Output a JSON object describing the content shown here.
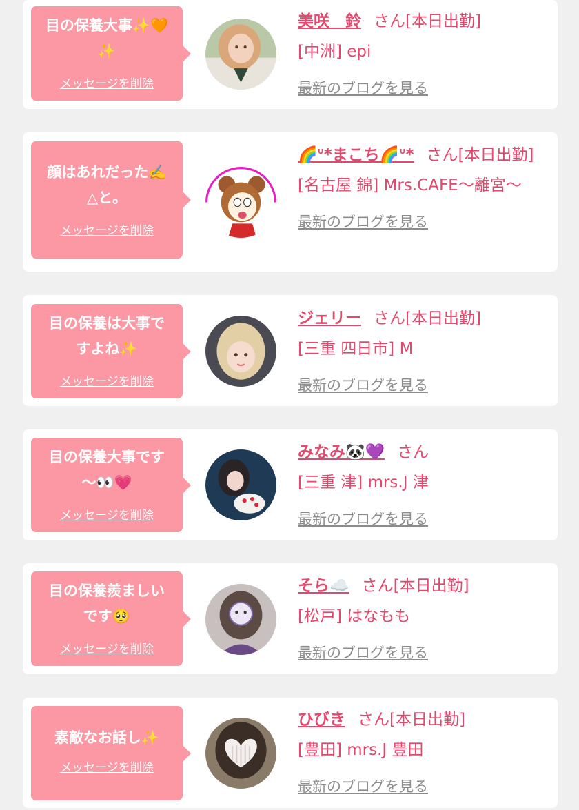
{
  "delete_label": "メッセージを削除",
  "san_suffix": "さん",
  "blog_label": "最新のブログを見る",
  "colors": {
    "bubble": "#fc97a4",
    "accent": "#e4486d",
    "muted": "#8c8c8c",
    "background": "#f0f0f0"
  },
  "messages": [
    {
      "bubble_text": "目の保養大事✨🧡\n✨",
      "name": "美咲　鈴",
      "status": "さん[本日出勤]",
      "shop": "[中洲] epi",
      "avatar_icon": "woman-portrait"
    },
    {
      "bubble_text": "顔はあれだった✍️\n△と。",
      "name": "🌈ᐡ*まこち🌈ᐡ*",
      "status": "さん[本日出勤]",
      "shop": "[名古屋 錦] Mrs.CAFE〜離宮〜",
      "avatar_icon": "cartoon-bear-girl"
    },
    {
      "bubble_text": "目の保養は大事で\nすよね✨",
      "name": "ジェリー",
      "status": "さん[本日出勤]",
      "shop": "[三重 四日市] M",
      "avatar_icon": "blonde-woman-portrait"
    },
    {
      "bubble_text": "目の保養大事です\n〜👀💗",
      "name": "みなみ🐼💜",
      "status": "さん",
      "shop": "[三重 津] mrs.J 津",
      "avatar_icon": "woman-with-cake"
    },
    {
      "bubble_text": "目の保養羨ましい\nです🥺",
      "name": "そら☁️",
      "status": "さん[本日出勤]",
      "shop": "[松戸] はなもも",
      "avatar_icon": "woman-hidden-face"
    },
    {
      "bubble_text": "素敵なお話し✨",
      "name": "ひびき",
      "status": "さん[本日出勤]",
      "shop": "[豊田] mrs.J 豊田",
      "avatar_icon": "woman-heart-covered-face"
    }
  ]
}
